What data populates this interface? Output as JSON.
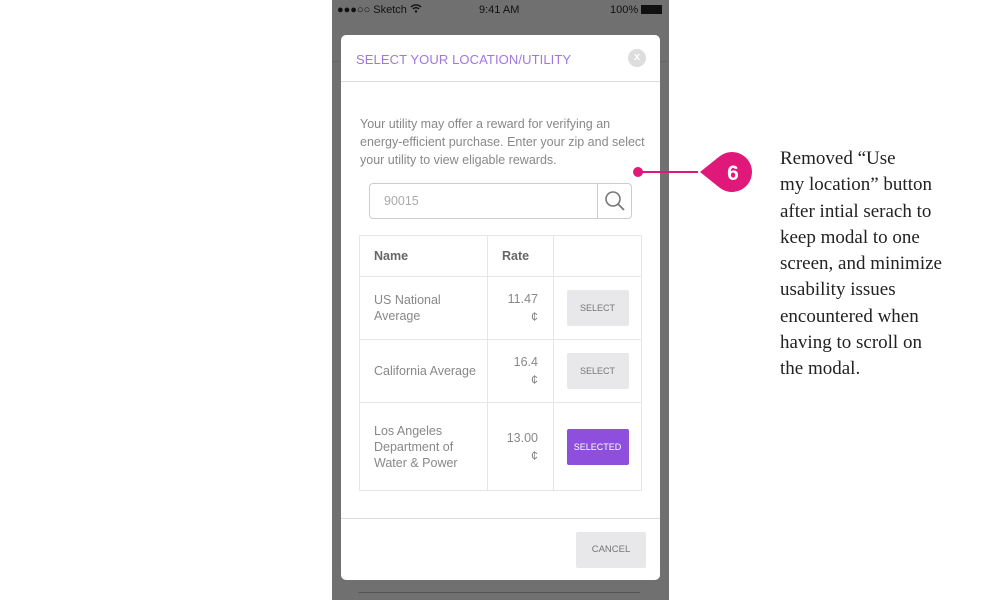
{
  "status_bar": {
    "carrier": "●●●○○ Sketch",
    "time": "9:41 AM",
    "battery": "100%"
  },
  "modal": {
    "title": "SELECT YOUR LOCATION/UTILITY",
    "close_label": "x",
    "intro": "Your utility may offer a reward for verifying an energy-efficient purchase. Enter your zip and select your utility to view eligable rewards.",
    "search": {
      "value": "90015"
    },
    "table": {
      "headers": [
        "Name",
        "Rate",
        ""
      ],
      "rows": [
        {
          "name": "US National Average",
          "rate": "11.47",
          "unit": "¢",
          "action": "SELECT"
        },
        {
          "name": "California Average",
          "rate": "16.4",
          "unit": "¢",
          "action": "SELECT"
        },
        {
          "name": "Los Angeles Department of Water & Power",
          "rate": "13.00",
          "unit": "¢",
          "action": "SELECTED"
        }
      ]
    },
    "cancel_label": "CANCEL"
  },
  "annotation": {
    "number": "6",
    "color": "#e0187a",
    "text": "Removed “Use\nmy location” button\nafter intial serach to\nkeep modal to one\nscreen, and minimize\nusability issues\nencountered when\nhaving to scroll on\nthe modal."
  },
  "colors": {
    "accent": "#8d4fdc",
    "title": "#a077e0"
  }
}
